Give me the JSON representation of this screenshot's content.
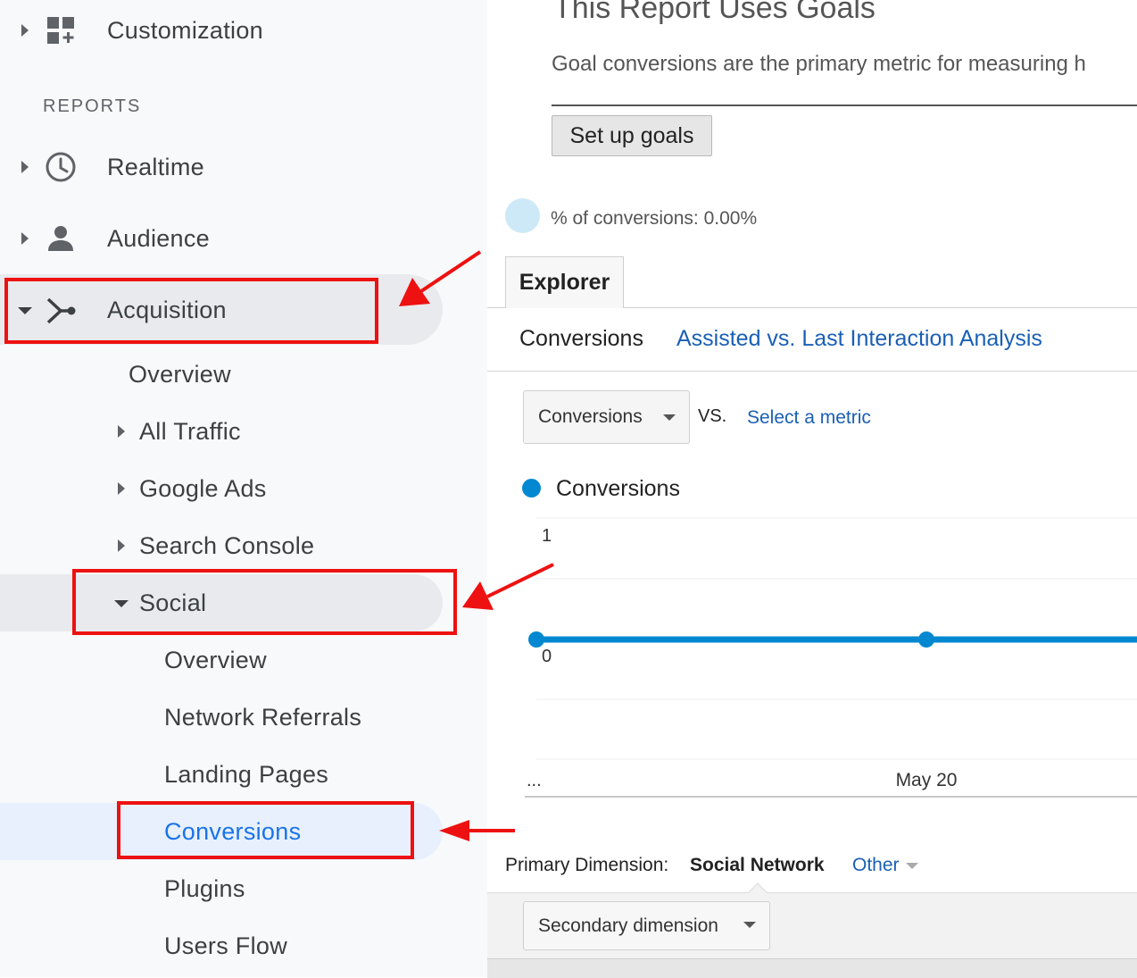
{
  "sidebar": {
    "customization": "Customization",
    "reports_section": "REPORTS",
    "realtime": "Realtime",
    "audience": "Audience",
    "acquisition": "Acquisition",
    "acquisition_items": {
      "overview": "Overview",
      "all_traffic": "All Traffic",
      "google_ads": "Google Ads",
      "search_console": "Search Console",
      "social": "Social"
    },
    "social_items": {
      "overview": "Overview",
      "network_referrals": "Network Referrals",
      "landing_pages": "Landing Pages",
      "conversions": "Conversions",
      "plugins": "Plugins",
      "users_flow": "Users Flow"
    }
  },
  "goals_panel": {
    "title": "This Report Uses Goals",
    "description": "Goal conversions are the primary metric for measuring h",
    "setup_button": "Set up goals",
    "conversion_rate": "% of conversions: 0.00%"
  },
  "explorer": {
    "tab": "Explorer",
    "subtabs": {
      "active": "Conversions",
      "link": "Assisted vs. Last Interaction Analysis"
    },
    "metric_dropdown": "Conversions",
    "vs_label": "VS.",
    "select_metric": "Select a metric",
    "legend": "Conversions"
  },
  "chart_data": {
    "type": "line",
    "series": [
      {
        "name": "Conversions",
        "values": [
          0,
          0,
          0
        ]
      }
    ],
    "x_labels": [
      "...",
      "May 20",
      ""
    ],
    "y_ticks": [
      "1",
      "0"
    ],
    "ylim": [
      0,
      1
    ],
    "grid": true,
    "color": "#0288d1"
  },
  "dimension": {
    "label": "Primary Dimension:",
    "value": "Social Network",
    "other": "Other",
    "secondary": "Secondary dimension"
  },
  "colors": {
    "link": "#1a73e8",
    "highlight_box": "#ee1111",
    "selected_bg": "#e8f0fe",
    "active_bg": "#e8eaed"
  }
}
